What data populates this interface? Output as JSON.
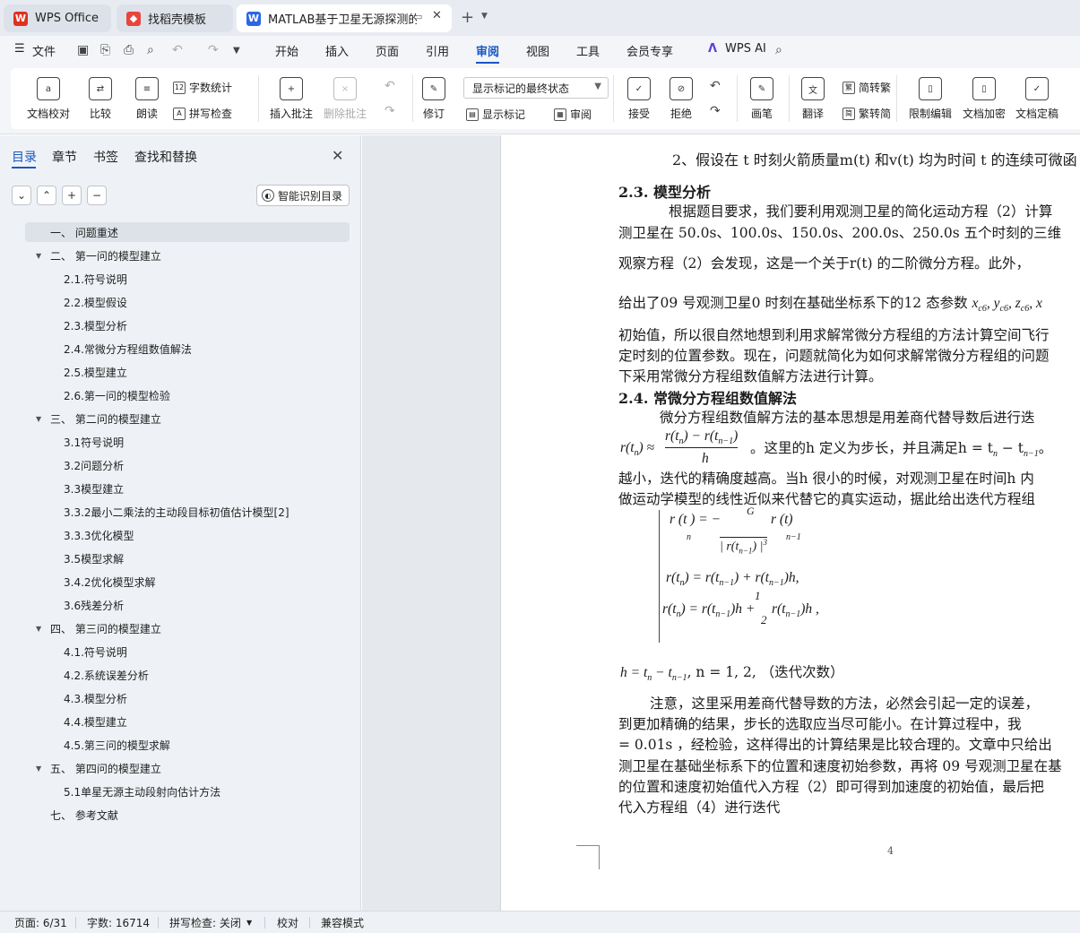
{
  "tabs": [
    {
      "label": "WPS Office",
      "icon": "wps-logo-icon"
    },
    {
      "label": "找稻壳模板",
      "icon": "docer-icon"
    },
    {
      "label": "MATLAB基于卫星无源探测的空",
      "icon": "word-doc-icon"
    }
  ],
  "menu": {
    "file": "文件",
    "items": [
      "开始",
      "插入",
      "页面",
      "引用",
      "审阅",
      "视图",
      "工具",
      "会员专享"
    ],
    "active": "审阅",
    "ai": "WPS AI"
  },
  "ribbon": {
    "proofread": "文档校对",
    "compare": "比较",
    "read_aloud": "朗读",
    "word_count": "字数统计",
    "spell_check": "拼写检查",
    "insert_comment": "插入批注",
    "delete_comment": "删除批注",
    "revise": "修订",
    "markup_mode": "显示标记的最终状态",
    "show_markup": "显示标记",
    "review": "审阅",
    "accept": "接受",
    "reject": "拒绝",
    "pen": "画笔",
    "translate": "翻译",
    "to_traditional": "简转繁",
    "to_simplified": "繁转简",
    "restrict_edit": "限制编辑",
    "encrypt": "文档加密",
    "finalize": "文档定稿"
  },
  "nav": {
    "tabs": [
      "目录",
      "章节",
      "书签",
      "查找和替换"
    ],
    "smart_toc": "智能识别目录",
    "toc": [
      {
        "label": "一、 问题重述",
        "level": 1,
        "selected": true
      },
      {
        "label": "二、 第一问的模型建立",
        "level": 1,
        "expanded": true
      },
      {
        "label": "2.1.符号说明",
        "level": 2
      },
      {
        "label": "2.2.模型假设",
        "level": 2
      },
      {
        "label": "2.3.模型分析",
        "level": 2
      },
      {
        "label": "2.4.常微分方程组数值解法",
        "level": 2
      },
      {
        "label": "2.5.模型建立",
        "level": 2
      },
      {
        "label": "2.6.第一问的模型检验",
        "level": 2
      },
      {
        "label": "三、 第二问的模型建立",
        "level": 1,
        "expanded": true
      },
      {
        "label": "3.1符号说明",
        "level": 2
      },
      {
        "label": "3.2问题分析",
        "level": 2
      },
      {
        "label": "3.3模型建立",
        "level": 2
      },
      {
        "label": "3.3.2最小二乘法的主动段目标初值估计模型[2]",
        "level": 2
      },
      {
        "label": "3.3.3优化模型",
        "level": 2
      },
      {
        "label": "3.5模型求解",
        "level": 2
      },
      {
        "label": "3.4.2优化模型求解",
        "level": 2
      },
      {
        "label": "3.6残差分析",
        "level": 2
      },
      {
        "label": "四、 第三问的模型建立",
        "level": 1,
        "expanded": true
      },
      {
        "label": "4.1.符号说明",
        "level": 2
      },
      {
        "label": "4.2.系统误差分析",
        "level": 2
      },
      {
        "label": "4.3.模型分析",
        "level": 2
      },
      {
        "label": "4.4.模型建立",
        "level": 2
      },
      {
        "label": "4.5.第三问的模型求解",
        "level": 2
      },
      {
        "label": "五、 第四问的模型建立",
        "level": 1,
        "expanded": true
      },
      {
        "label": "5.1单星无源主动段射向估计方法",
        "level": 2
      },
      {
        "label": "七、 参考文献",
        "level": 1
      }
    ]
  },
  "doc": {
    "l1": "2、假设在 t 时刻火箭质量m(t) 和v(t) 均为时间 t 的连续可微函",
    "h23": "2.3. 模型分析",
    "l2": "根据题目要求，我们要利用观测卫星的简化运动方程（2）计算",
    "l3": "测卫星在 50.0s、100.0s、150.0s、200.0s、250.0s 五个时刻的三维",
    "l4": "观察方程（2）会发现，这是一个关于r(t) 的二阶微分方程。此外，",
    "l5": "给出了09 号观测卫星0 时刻在基础坐标系下的12 态参数",
    "l5b": "x",
    "l5c": "c6",
    "l5d": ", y",
    "l5e": ", z",
    "l5f": ", x",
    "l6": "初始值，所以很自然地想到利用求解常微分方程组的方法计算空间飞行",
    "l7": "定时刻的位置参数。现在，问题就简化为如何求解常微分方程组的问题",
    "l8": "下采用常微分方程组数值解方法进行计算。",
    "h24": "2.4. 常微分方程组数值解法",
    "l9": "微分方程组数值解方法的基本思想是用差商代替导数后进行迭",
    "eq1_lhs": "r(t",
    "eq1_n": "n",
    "eq1_mid": ") ≈",
    "eq1_num": "r(t",
    "eq1_num2": ") − r(t",
    "eq1_num3": ")",
    "eq1_sub": "n−1",
    "eq1_den": "h",
    "l10": "。这里的h 定义为步长，并且满足h = t",
    "l10b": " − t",
    "l10c": "。",
    "l11": "越小，迭代的精确度越高。当h 很小的时候，对观测卫星在时间h 内",
    "l12": "做运动学模型的线性近似来代替它的真实运动，据此给出迭代方程组",
    "sys1": "r (t ) = −",
    "sys1_frac_top": "G",
    "sys1_frac_bot": "| r(t",
    "sys1_frac_bot2": ") |",
    "sys1_exp": "3",
    "sys1_tail": "r    (t)",
    "sys1_sub_n": "n",
    "sys1_sub_n1": "n−1",
    "sys2": "r(t",
    "sys2b": ") = r(t",
    "sys2c": ") + r(t",
    "sys2d": ")h,",
    "sys3": "r(t",
    "sys3b": ") = r(t",
    "sys3c": ")h +",
    "sys3_half_top": "1",
    "sys3_half_bot": "2",
    "sys3d": "r(t",
    "sys3e": ")h ,",
    "l13": "h = t",
    "l13b": " − t",
    "l13c": ",       n = 1, 2,     （迭代次数）",
    "l14": "注意，这里采用差商代替导数的方法，必然会引起一定的误差，",
    "l15": "到更加精确的结果，步长的选取应当尽可能小。在计算过程中，我",
    "l16": "= 0.01s ，经检验，这样得出的计算结果是比较合理的。文章中只给出",
    "l17": "测卫星在基础坐标系下的位置和速度初始参数，再将 09 号观测卫星在基",
    "l18": "的位置和速度初始值代入方程（2）即可得到加速度的初始值，最后把",
    "l19": "代入方程组（4）进行迭代",
    "page_number": "4"
  },
  "status": {
    "page": "页面: 6/31",
    "words": "字数: 16714",
    "spell": "拼写检查: 关闭",
    "proof": "校对",
    "compat": "兼容模式"
  }
}
